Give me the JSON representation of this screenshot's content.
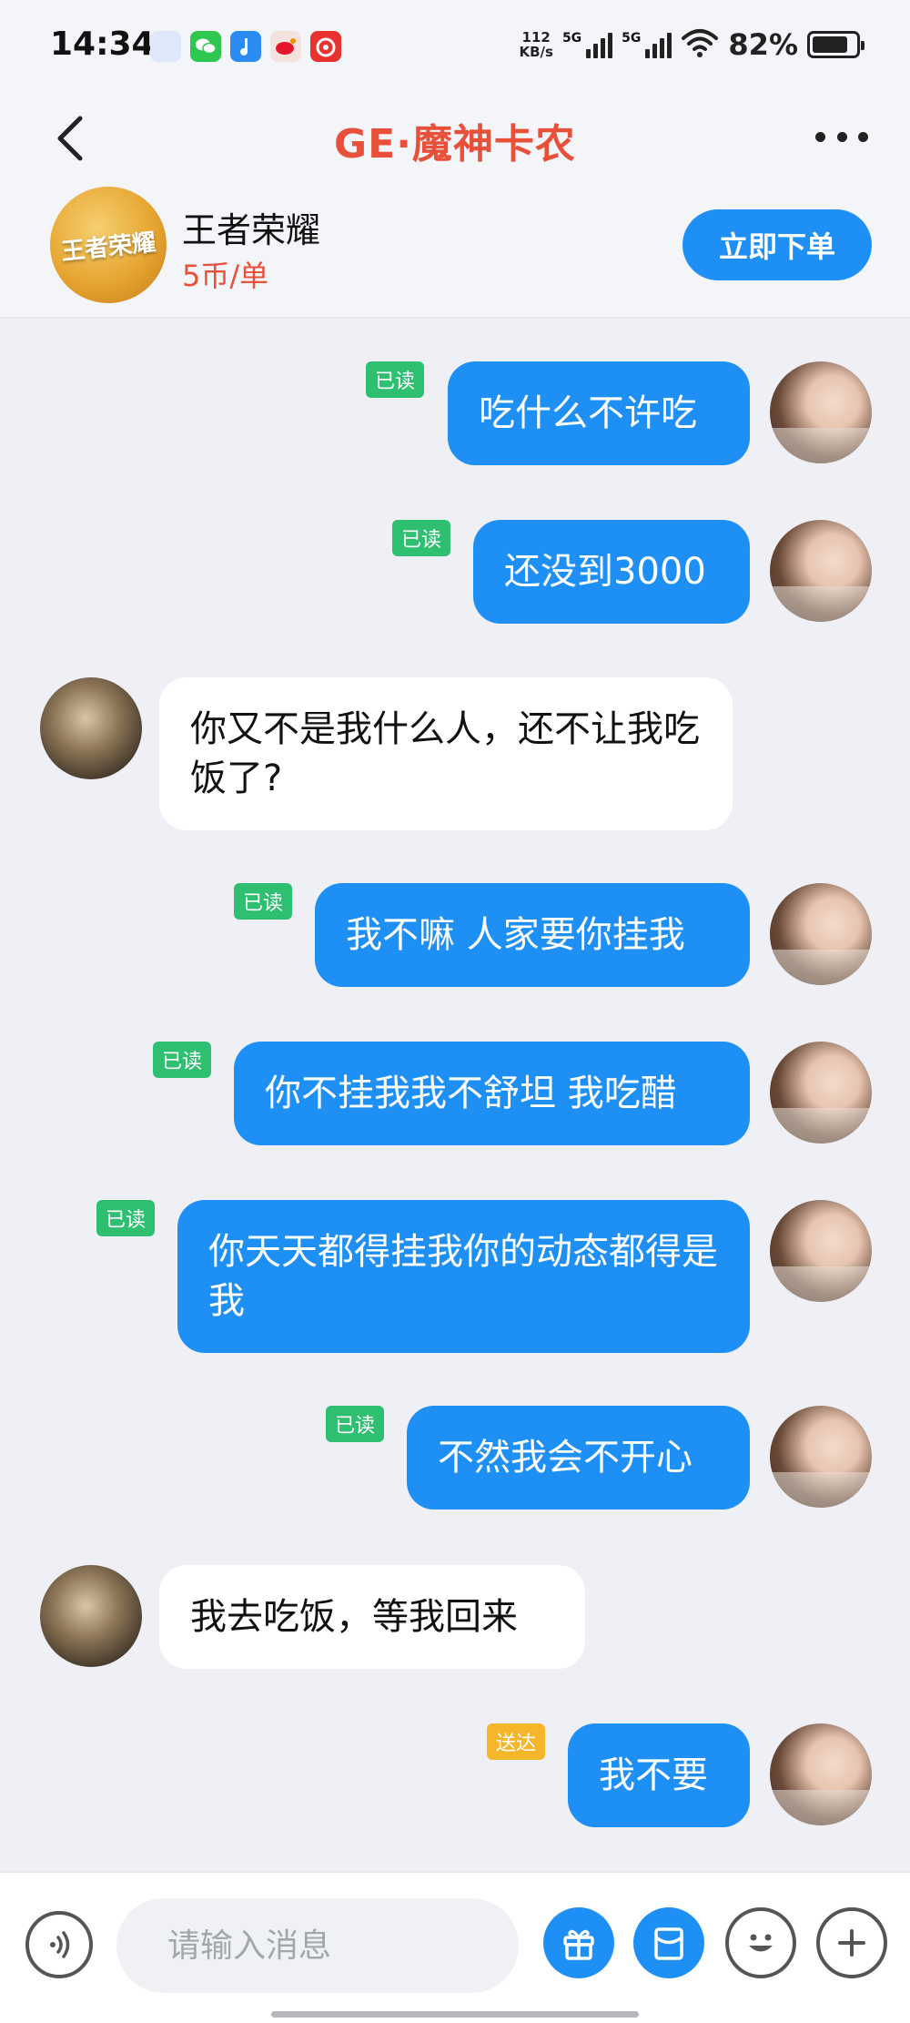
{
  "status_bar": {
    "time": "14:34",
    "net_speed_value": "112",
    "net_speed_unit": "KB/s",
    "sim1_label": "5G",
    "sim2_label": "5G",
    "battery_percent": "82%",
    "battery_level": 0.82,
    "app_icons": [
      {
        "name": "cloud-app-icon",
        "color": "#dfe7fb"
      },
      {
        "name": "wechat-icon",
        "color": "#2dc84d"
      },
      {
        "name": "music-note-app-icon",
        "color": "#2a8bf2"
      },
      {
        "name": "weibo-icon",
        "color": "#f3e2de"
      },
      {
        "name": "netease-music-icon",
        "color": "#e8322f"
      }
    ]
  },
  "header": {
    "title": "GE·魔神卡农"
  },
  "product": {
    "logo_text": "王者荣耀",
    "game_name": "王者荣耀",
    "price": "5币/单",
    "order_button": "立即下单"
  },
  "messages": [
    {
      "side": "me",
      "text": "吃什么不许吃",
      "status": "已读"
    },
    {
      "side": "me",
      "text": "还没到3000",
      "status": "已读"
    },
    {
      "side": "them",
      "text": "你又不是我什么人，还不让我吃饭了?"
    },
    {
      "side": "me",
      "text": "我不嘛 人家要你挂我",
      "status": "已读"
    },
    {
      "side": "me",
      "text": "你不挂我我不舒坦 我吃醋",
      "status": "已读"
    },
    {
      "side": "me",
      "text": "你天天都得挂我你的动态都得是我",
      "status": "已读"
    },
    {
      "side": "me",
      "text": "不然我会不开心",
      "status": "已读"
    },
    {
      "side": "them",
      "text": "我去吃饭，等我回来"
    },
    {
      "side": "me",
      "text": "我不要",
      "status": "送达"
    }
  ],
  "input_bar": {
    "placeholder": "请输入消息"
  },
  "colors": {
    "accent_blue": "#1e90f5",
    "title_red": "#e8503a",
    "read_green": "#2fbf71",
    "delivered_yellow": "#f5b62a"
  }
}
